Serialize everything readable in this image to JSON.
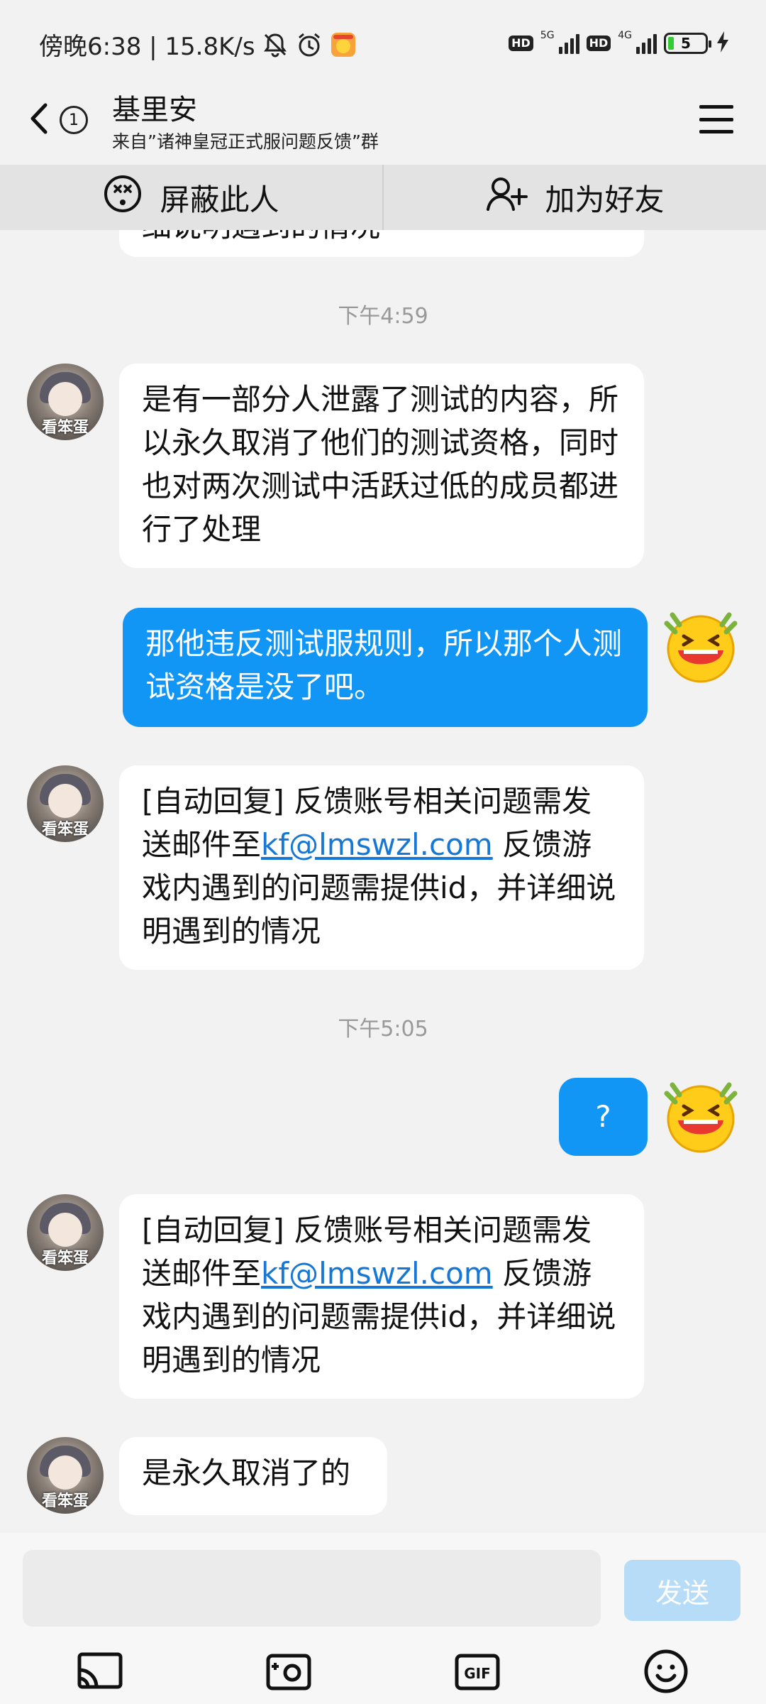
{
  "status_bar": {
    "time_text": "傍晚6:38 | 15.8K/s",
    "hd1": "HD",
    "net1": "5G",
    "hd2": "HD",
    "net2": "4G",
    "battery": "5"
  },
  "header": {
    "back_count": "1",
    "title": "基里安",
    "subtitle": "来自”诸神皇冠正式服问题反馈”群"
  },
  "actions": {
    "block": "屏蔽此人",
    "add_friend": "加为好友"
  },
  "chat": {
    "partial_text": "细说明遇到的情况",
    "messages": [
      {
        "type": "time",
        "text": "下午4:59"
      },
      {
        "type": "in",
        "avatar_caption": "看笨蛋",
        "text": "是有一部分人泄露了测试的内容，所以永久取消了他们的测试资格，同时也对两次测试中活跃过低的成员都进行了处理"
      },
      {
        "type": "out",
        "text": "那他违反测试服规则，所以那个人测试资格是没了吧。"
      },
      {
        "type": "in",
        "avatar_caption": "看笨蛋",
        "pre": "[自动回复] 反馈账号相关问题需发送邮件至",
        "link": "kf@lmswzl.com",
        "post": " 反馈游戏内遇到的问题需提供id，并详细说明遇到的情况"
      },
      {
        "type": "time",
        "text": "下午5:05"
      },
      {
        "type": "out",
        "text": "?"
      },
      {
        "type": "in",
        "avatar_caption": "看笨蛋",
        "pre": "[自动回复] 反馈账号相关问题需发送邮件至",
        "link": "kf@lmswzl.com",
        "post": " 反馈游戏内遇到的问题需提供id，并详细说明遇到的情况"
      },
      {
        "type": "in",
        "avatar_caption": "看笨蛋",
        "text": "是永久取消了的"
      }
    ]
  },
  "input": {
    "placeholder": "",
    "send_label": "发送"
  },
  "icons": {
    "accent": "#1296f5",
    "toolbar": [
      "screen-cast-icon",
      "camera-icon",
      "gif-icon",
      "emoji-icon"
    ]
  }
}
